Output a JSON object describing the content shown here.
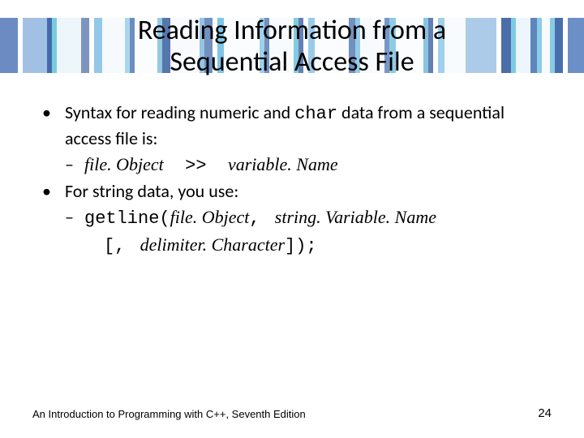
{
  "title_line1": "Reading Information from a",
  "title_line2": "Sequential Access File",
  "bullet1_pre": "Syntax for reading numeric and ",
  "bullet1_code": "char",
  "bullet1_post": " data from a sequential access file is:",
  "sub1_a": "file. Object",
  "sub1_op": "  >>  ",
  "sub1_b": "variable. Name",
  "bullet2": "For string data, you use:",
  "sub2_func": "getline(",
  "sub2_arg1": "file. Object",
  "sub2_comma": ", ",
  "sub2_arg2": "string. Variable. Name",
  "sub3_open": "[, ",
  "sub3_arg": "delimiter. Character",
  "sub3_close": "]);",
  "footer_left": "An Introduction to Programming with C++, Seventh Edition",
  "footer_right": "24",
  "marker_bullet": "•",
  "marker_dash": "–"
}
